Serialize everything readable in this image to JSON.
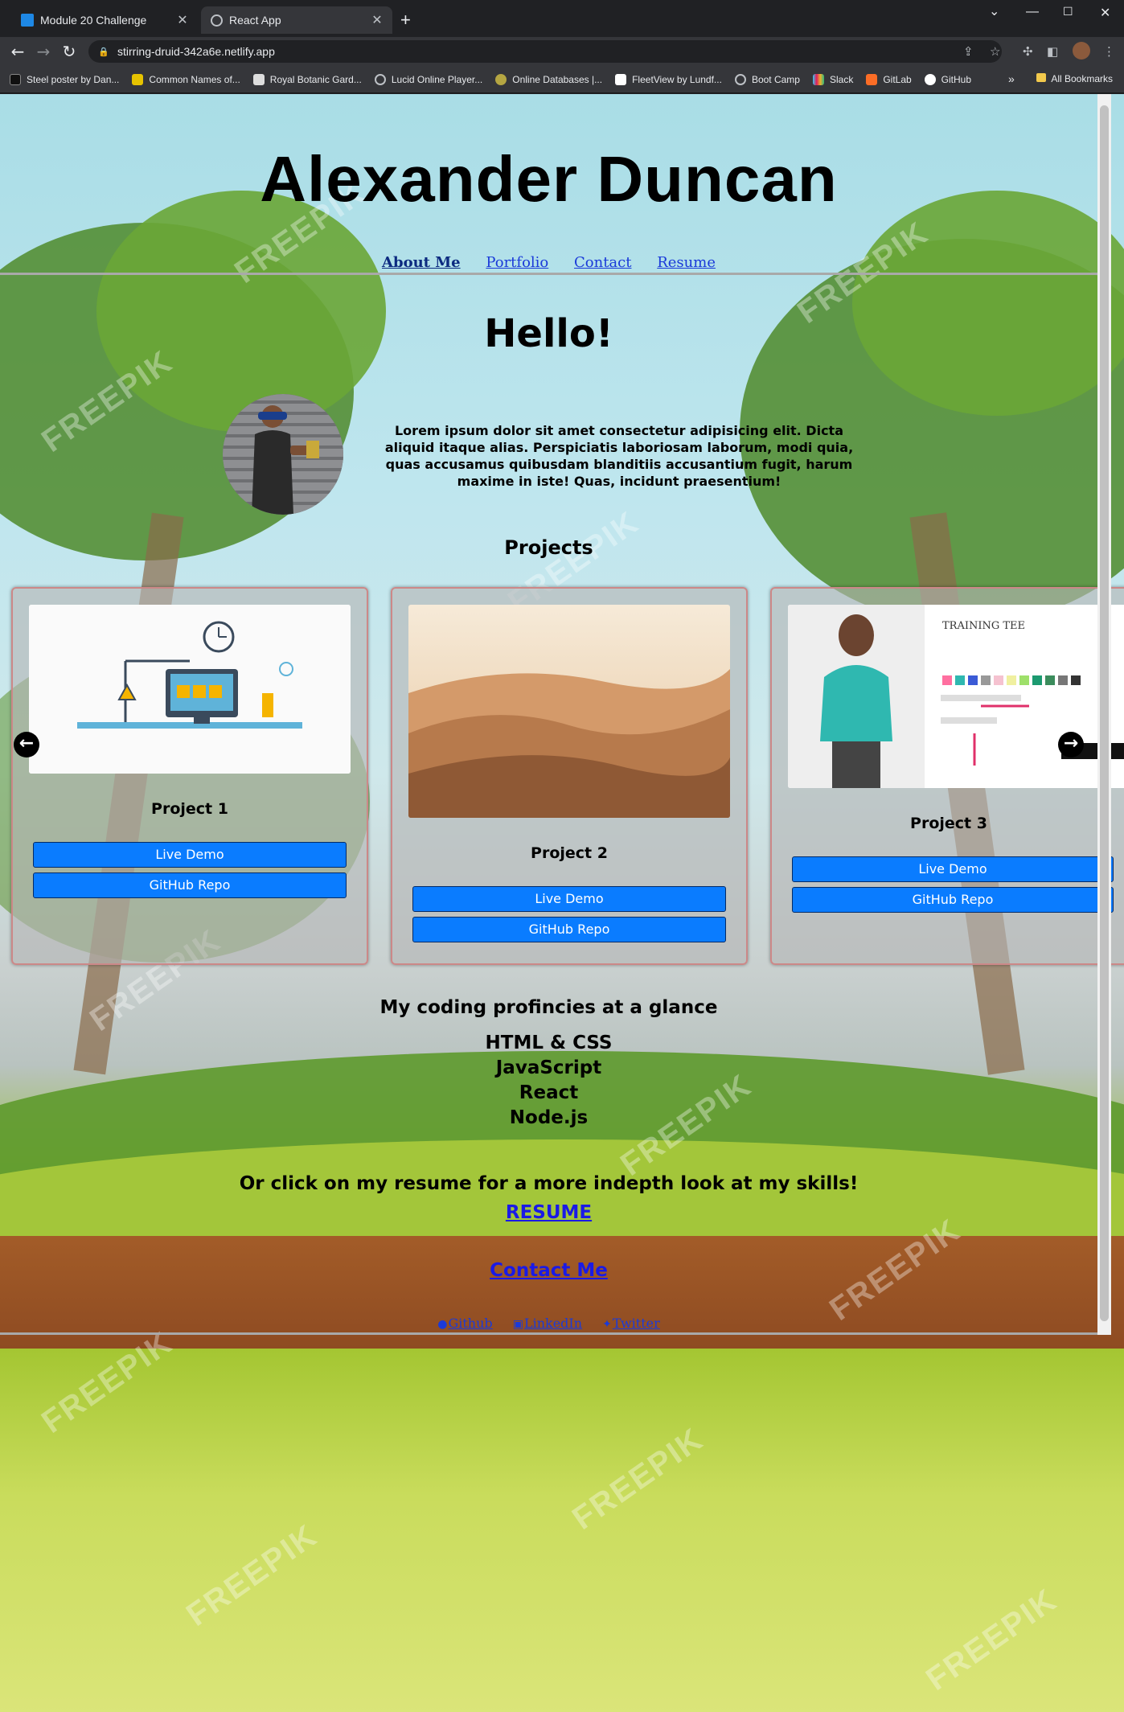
{
  "browser": {
    "tabs": [
      {
        "title": "Module 20 Challenge",
        "active": false,
        "favicon_color": "#1e88e5"
      },
      {
        "title": "React App",
        "active": true
      }
    ],
    "address": "stirring-druid-342a6e.netlify.app",
    "bookmarks": [
      "Steel poster by Dan...",
      "Common Names of...",
      "Royal Botanic Gard...",
      "Lucid Online Player...",
      "Online Databases |...",
      "FleetView by Lundf...",
      "Boot Camp",
      "Slack",
      "GitLab",
      "GitHub"
    ],
    "overflow_label": "»",
    "all_bookmarks": "All Bookmarks"
  },
  "site": {
    "name": "Alexander Duncan",
    "nav": [
      {
        "label": "About Me",
        "current": true
      },
      {
        "label": "Portfolio",
        "current": false
      },
      {
        "label": "Contact",
        "current": false
      },
      {
        "label": "Resume",
        "current": false
      }
    ],
    "greeting": "Hello!",
    "bio": "Lorem ipsum dolor sit amet consectetur adipisicing elit. Dicta aliquid itaque alias. Perspiciatis laboriosam laborum, modi quia, quas accusamus quibusdam blanditiis accusantium fugit, harum maxime in iste! Quas, incidunt praesentium!",
    "projects_heading": "Projects",
    "projects": [
      {
        "title": "Project 1",
        "demo_label": "Live Demo",
        "repo_label": "GitHub Repo"
      },
      {
        "title": "Project 2",
        "demo_label": "Live Demo",
        "repo_label": "GitHub Repo"
      },
      {
        "title": "Project 3",
        "demo_label": "Live Demo",
        "repo_label": "GitHub Repo",
        "shirt_label": "TRAINING TEE"
      }
    ],
    "proficiency_heading": "My coding profincies at a glance",
    "skills": [
      "HTML & CSS",
      "JavaScript",
      "React",
      "Node.js"
    ],
    "resume_cta": "Or click on my resume for a more indepth look at my skills!",
    "resume_link": "RESUME",
    "contact_link": "Contact Me",
    "social": [
      {
        "label": "Github",
        "icon": "github-icon"
      },
      {
        "label": "LinkedIn",
        "icon": "linkedin-icon"
      },
      {
        "label": "Twitter",
        "icon": "twitter-icon"
      }
    ],
    "watermark": "FREEPIK"
  },
  "colors": {
    "button": "#0a7cff",
    "link": "#1a3ad9",
    "chrome_dark": "#202124",
    "chrome_toolbar": "#35363a"
  }
}
